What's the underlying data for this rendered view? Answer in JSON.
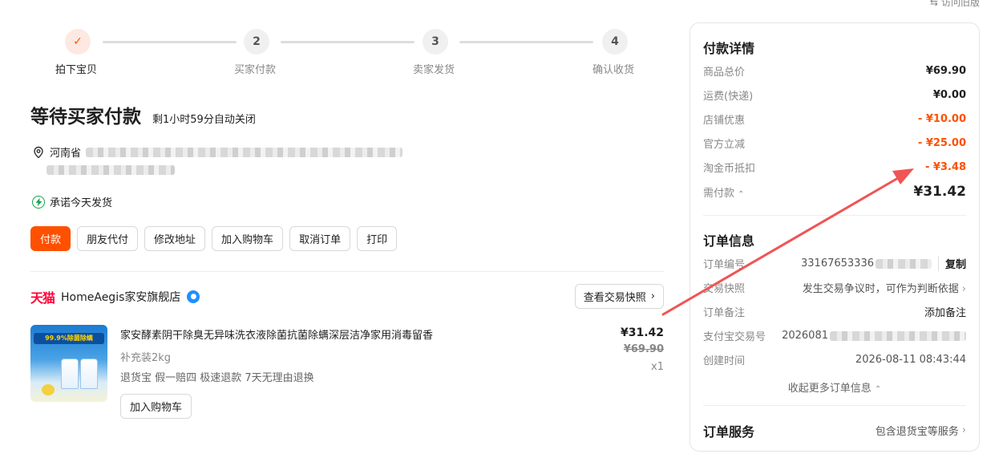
{
  "top_link": "访问旧版",
  "steps": [
    {
      "label": "拍下宝贝",
      "num": "✓",
      "done": true
    },
    {
      "label": "买家付款",
      "num": "2"
    },
    {
      "label": "卖家发货",
      "num": "3"
    },
    {
      "label": "确认收货",
      "num": "4"
    }
  ],
  "status": {
    "title": "等待买家付款",
    "countdown": "剩1小时59分自动关闭"
  },
  "address": {
    "province": "河南省"
  },
  "promise": "承诺今天发货",
  "actions": [
    "付款",
    "朋友代付",
    "修改地址",
    "加入购物车",
    "取消订单",
    "打印"
  ],
  "shop": {
    "platform": "天猫",
    "name": "HomeAegis家安旗舰店",
    "snapshot_button": "查看交易快照"
  },
  "item": {
    "thumb_banner": "99.9%除菌除螨",
    "title": "家安酵素阴干除臭无异味洗衣液除菌抗菌除螨深层洁净家用消毒留香",
    "spec": "补充装2kg",
    "tags": "退货宝 假一赔四 极速退款 7天无理由退换",
    "price": "¥31.42",
    "original_price": "¥69.90",
    "quantity": "x1",
    "cart_button": "加入购物车"
  },
  "payment": {
    "title": "付款详情",
    "rows": [
      {
        "label": "商品总价",
        "value": "¥69.90"
      },
      {
        "label": "运费(快递)",
        "value": "¥0.00"
      },
      {
        "label": "店铺优惠",
        "value": "- ¥10.00"
      },
      {
        "label": "官方立减",
        "value": "- ¥25.00"
      },
      {
        "label": "淘金币抵扣",
        "value": "- ¥3.48"
      }
    ],
    "total_label": "需付款",
    "total_value": "¥31.42"
  },
  "order": {
    "title": "订单信息",
    "number_label": "订单编号",
    "number_value": "33167653336",
    "copy": "复制",
    "snapshot_label": "交易快照",
    "snapshot_value": "发生交易争议时，可作为判断依据",
    "note_label": "订单备注",
    "note_value": "添加备注",
    "alipay_label": "支付宝交易号",
    "alipay_value": "2026081",
    "created_label": "创建时间",
    "created_value": "2026-08-11 08:43:44",
    "collapse": "收起更多订单信息"
  },
  "service": {
    "title": "订单服务",
    "value": "包含退货宝等服务"
  },
  "colors": {
    "accent": "#ff5000",
    "tmall": "#ff0036",
    "green": "#16a34a"
  }
}
